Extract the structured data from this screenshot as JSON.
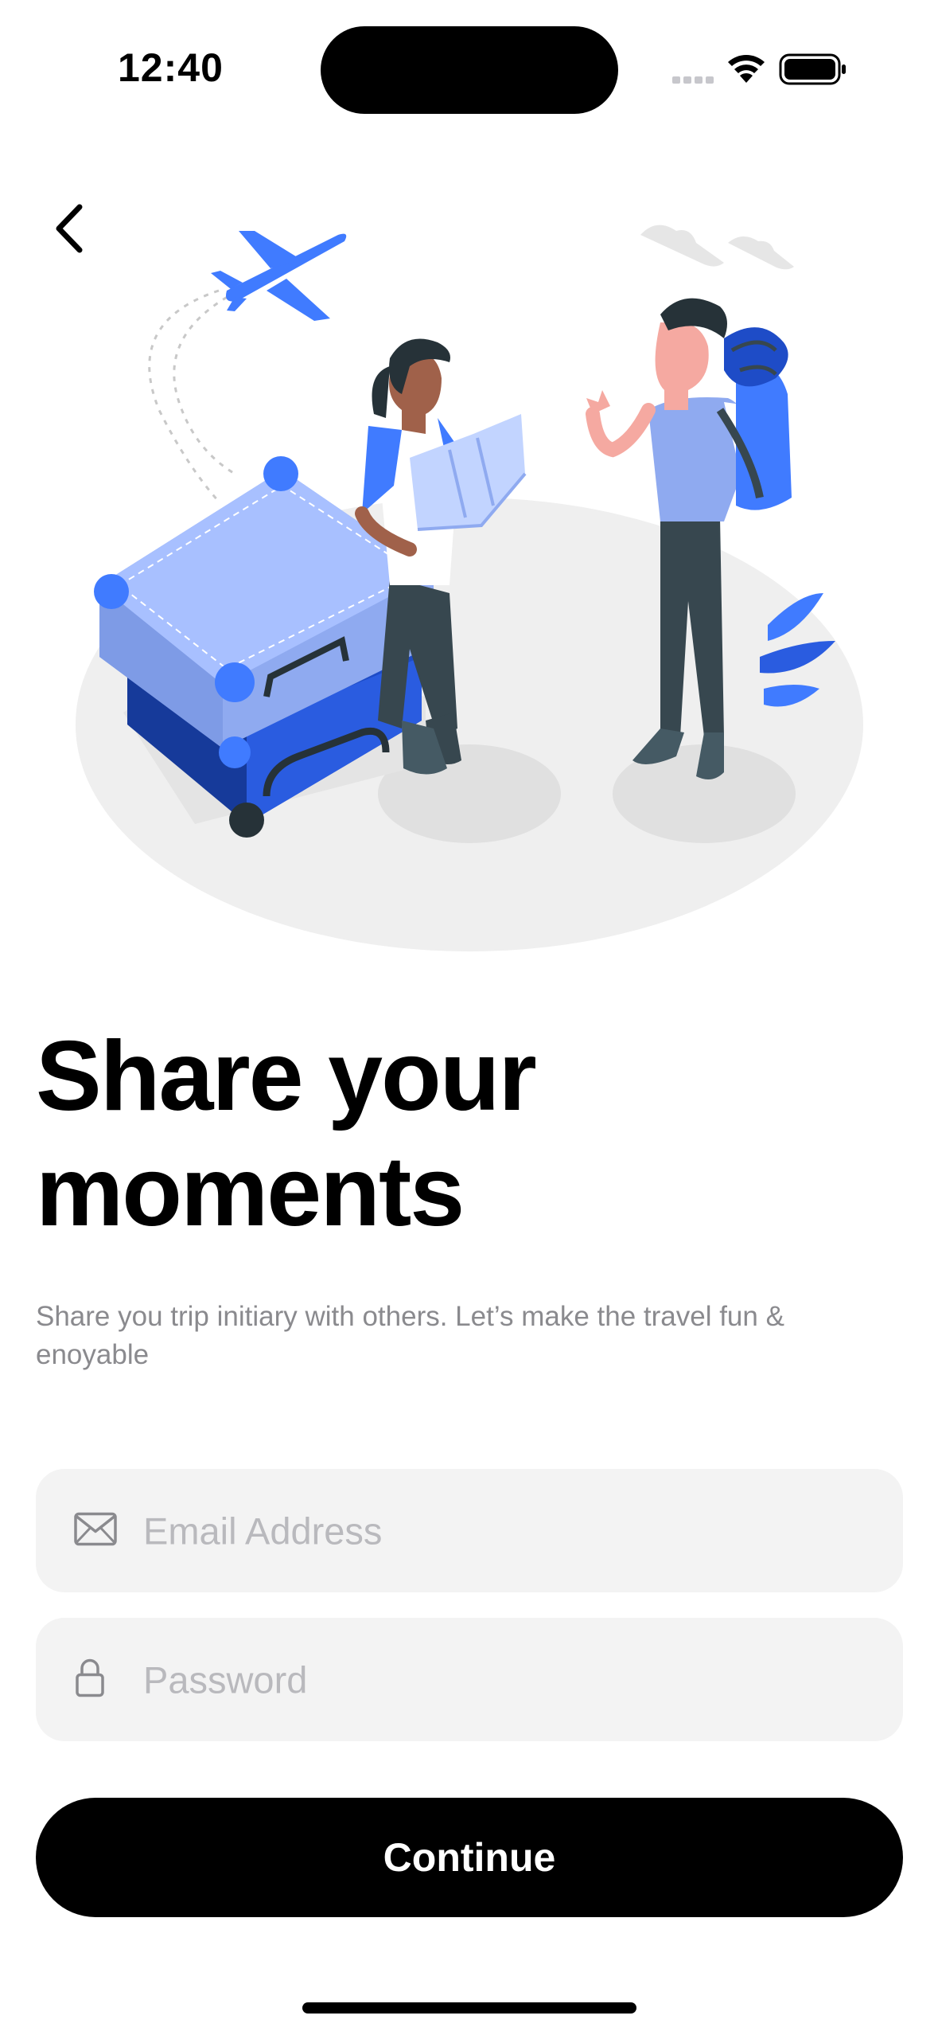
{
  "status_bar": {
    "time": "12:40",
    "icons": [
      "signal-dots-icon",
      "wifi-icon",
      "battery-icon"
    ]
  },
  "navigation": {
    "back_icon": "chevron-left-icon"
  },
  "illustration": {
    "subject": "travelers-with-luggage-illustration",
    "colors": {
      "accent_blue": "#407BFF",
      "light_blue": "#A8C0FF",
      "dark_gray": "#37474F",
      "floor_gray": "#F0F0F0"
    }
  },
  "hero": {
    "title_line1": "Share your",
    "title_line2": "moments",
    "subtitle": "Share you trip initiary with others. Let’s make the travel fun & enoyable"
  },
  "form": {
    "email": {
      "placeholder": "Email Address",
      "icon": "envelope-icon"
    },
    "password": {
      "placeholder": "Password",
      "icon": "lock-icon"
    }
  },
  "actions": {
    "continue_label": "Continue"
  },
  "colors": {
    "background": "#FFFFFF",
    "field_background": "#F3F3F3",
    "placeholder": "#B9B9BD",
    "subtitle": "#8A8A8E",
    "button": "#000000",
    "button_text": "#FFFFFF"
  }
}
